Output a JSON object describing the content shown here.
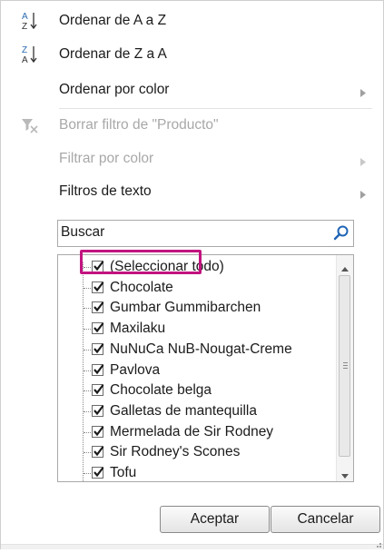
{
  "menu": {
    "sort_az": {
      "label": "Ordenar de A a Z",
      "icon": "sort-ascending-icon"
    },
    "sort_za": {
      "label": "Ordenar de Z a A",
      "icon": "sort-descending-icon"
    },
    "sort_by_color": {
      "label": "Ordenar por color",
      "has_submenu": true
    },
    "clear_filter": {
      "label": "Borrar filtro de \"Producto\"",
      "icon": "clear-filter-icon",
      "disabled": true
    },
    "filter_by_color": {
      "label": "Filtrar por color",
      "has_submenu": true,
      "disabled": true
    },
    "text_filters": {
      "label": "Filtros de texto",
      "has_submenu": true
    }
  },
  "search": {
    "placeholder": "Buscar",
    "value": "",
    "icon": "search-icon"
  },
  "list": {
    "items": [
      {
        "label": "(Seleccionar todo)",
        "checked": true
      },
      {
        "label": "Chocolate",
        "checked": true
      },
      {
        "label": "Gumbar Gummibarchen",
        "checked": true
      },
      {
        "label": "Maxilaku",
        "checked": true
      },
      {
        "label": "NuNuCa NuB-Nougat-Creme",
        "checked": true
      },
      {
        "label": "Pavlova",
        "checked": true
      },
      {
        "label": "Chocolate belga",
        "checked": true
      },
      {
        "label": "Galletas de mantequilla",
        "checked": true
      },
      {
        "label": "Mermelada de Sir Rodney",
        "checked": true
      },
      {
        "label": "Sir Rodney's Scones",
        "checked": true
      },
      {
        "label": "Tofu",
        "checked": true
      }
    ]
  },
  "buttons": {
    "accept": "Aceptar",
    "cancel": "Cancelar"
  },
  "colors": {
    "highlight": "#c2147f",
    "search_icon": "#1e64b4"
  }
}
